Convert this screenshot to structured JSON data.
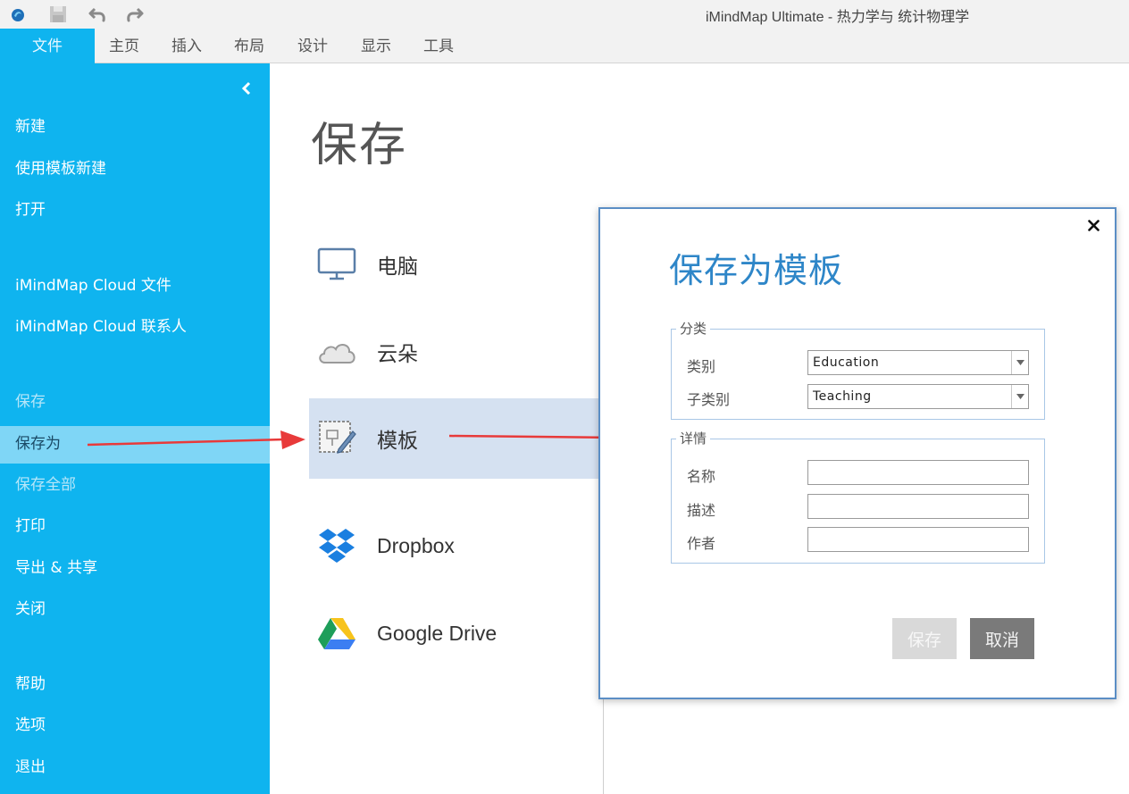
{
  "window": {
    "title": "iMindMap Ultimate - 热力学与 统计物理学"
  },
  "ribbon": {
    "tabs": [
      {
        "label": "文件"
      },
      {
        "label": "主页"
      },
      {
        "label": "插入"
      },
      {
        "label": "布局"
      },
      {
        "label": "设计"
      },
      {
        "label": "显示"
      },
      {
        "label": "工具"
      }
    ]
  },
  "sidebar": {
    "items": [
      {
        "label": "新建"
      },
      {
        "label": "使用模板新建"
      },
      {
        "label": "打开"
      },
      {
        "label": "iMindMap Cloud 文件"
      },
      {
        "label": "iMindMap Cloud 联系人"
      },
      {
        "label": "保存"
      },
      {
        "label": "保存为"
      },
      {
        "label": "保存全部"
      },
      {
        "label": "打印"
      },
      {
        "label": "导出 & 共享"
      },
      {
        "label": "关闭"
      },
      {
        "label": "帮助"
      },
      {
        "label": "选项"
      },
      {
        "label": "退出"
      }
    ]
  },
  "main": {
    "heading": "保存",
    "locations": [
      {
        "label": "电脑",
        "icon": "monitor-icon"
      },
      {
        "label": "云朵",
        "icon": "cloud-icon"
      },
      {
        "label": "模板",
        "icon": "template-icon"
      },
      {
        "label": "Dropbox",
        "icon": "dropbox-icon"
      },
      {
        "label": "Google Drive",
        "icon": "google-drive-icon"
      }
    ]
  },
  "dialog": {
    "title": "保存为模板",
    "category_group": {
      "legend": "分类",
      "category_label": "类别",
      "category_value": "Education",
      "subcategory_label": "子类别",
      "subcategory_value": "Teaching"
    },
    "details_group": {
      "legend": "详情",
      "name_label": "名称",
      "name_value": "",
      "description_label": "描述",
      "description_value": "",
      "author_label": "作者",
      "author_value": ""
    },
    "save_button": "保存",
    "cancel_button": "取消"
  },
  "colors": {
    "sidebar": "#0fb4ef",
    "sidebar_selected": "#7fd6f6",
    "dialog_title": "#2e86c8",
    "arrow": "#e83a3a",
    "selected_location": "#d5e1f1"
  }
}
